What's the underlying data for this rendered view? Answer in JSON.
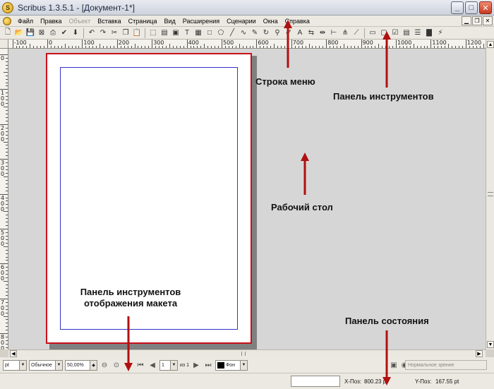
{
  "window": {
    "title": "Scribus 1.3.5.1 - [Документ-1*]",
    "logo": "S",
    "buttons": {
      "minimize": "_",
      "maximize": "□",
      "close": "✕"
    }
  },
  "menubar": {
    "items": [
      {
        "label": "Файл",
        "enabled": true
      },
      {
        "label": "Правка",
        "enabled": true
      },
      {
        "label": "Объект",
        "enabled": false
      },
      {
        "label": "Вставка",
        "enabled": true
      },
      {
        "label": "Страница",
        "enabled": true
      },
      {
        "label": "Вид",
        "enabled": true
      },
      {
        "label": "Расширения",
        "enabled": true
      },
      {
        "label": "Сценарии",
        "enabled": true
      },
      {
        "label": "Окна",
        "enabled": true
      },
      {
        "label": "Справка",
        "enabled": true
      }
    ],
    "mdi_buttons": {
      "minimize": "▁",
      "restore": "❐",
      "close": "✕"
    }
  },
  "toolbar": {
    "icons": [
      "new-document-icon",
      "open-icon",
      "save-icon",
      "close-document-icon",
      "print-icon",
      "preflight-icon",
      "pdf-export-icon",
      "sep",
      "undo-icon",
      "redo-icon",
      "cut-icon",
      "copy-icon",
      "paste-icon",
      "sep",
      "select-icon",
      "text-frame-icon",
      "image-frame-icon",
      "render-frame-icon",
      "table-icon",
      "shape-icon",
      "polygon-icon",
      "line-icon",
      "bezier-icon",
      "freehand-icon",
      "rotate-icon",
      "zoom-icon",
      "edit-contents-icon",
      "edit-text-icon",
      "link-frames-icon",
      "unlink-frames-icon",
      "measure-icon",
      "copy-properties-icon",
      "eyedropper-icon",
      "sep",
      "pdf-push-button-icon",
      "pdf-text-field-icon",
      "pdf-checkbox-icon",
      "pdf-combo-box-icon",
      "pdf-list-box-icon",
      "pdf-annotation-icon",
      "pdf-link-icon"
    ]
  },
  "rulers": {
    "horizontal_labels": [
      "-100",
      "0",
      "100",
      "200",
      "300",
      "400",
      "500",
      "600",
      "700",
      "800",
      "900",
      "1000",
      "1100",
      "1200"
    ],
    "vertical_labels": [
      "0",
      "100",
      "200",
      "300",
      "400",
      "500",
      "600",
      "700",
      "800"
    ]
  },
  "layout_bar": {
    "unit": "pt",
    "mode": "Обычное",
    "zoom": "50,00%",
    "page_number": "1",
    "page_of": "из 1",
    "layer": "Фон"
  },
  "view_mode": "Нормальное зрение",
  "status": {
    "x_label": "X-Поз:",
    "x_value": "800.23 pt",
    "y_label": "Y-Поз:",
    "y_value": "167.55 pt"
  },
  "annotations": {
    "menu_bar": "Строка меню",
    "toolbar": "Панель инструментов",
    "desktop": "Рабочий стол",
    "layout_toolbar_line1": "Панель инструментов",
    "layout_toolbar_line2": "отображения макета",
    "status_bar": "Панель состояния"
  },
  "colors": {
    "page_border": "#c8101a",
    "margin_guides": "#3333cc",
    "arrow": "#b01010",
    "desktop": "#d6d6d6"
  }
}
